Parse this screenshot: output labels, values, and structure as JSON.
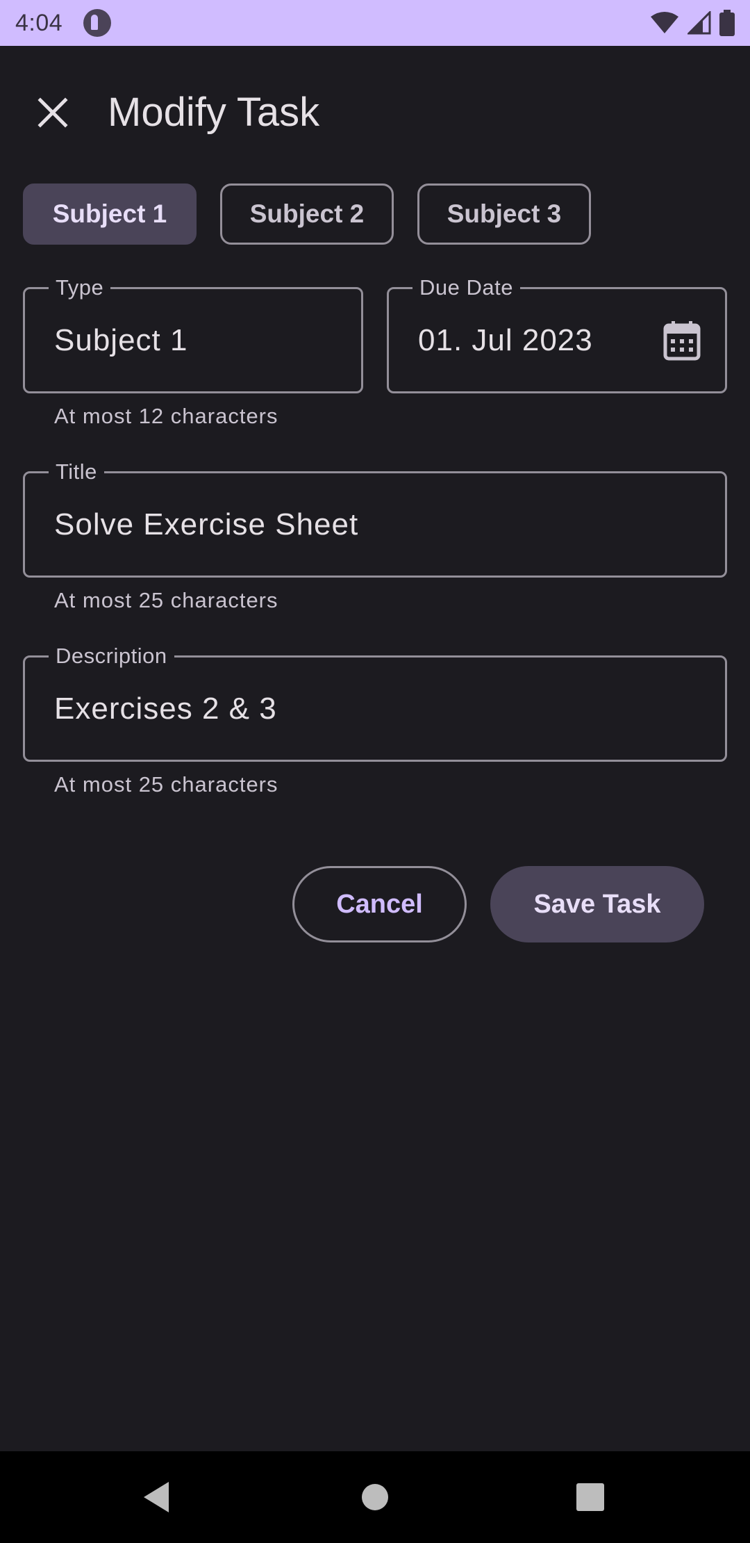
{
  "status_bar": {
    "time": "4:04",
    "icons": [
      "app-notification-icon",
      "wifi-icon",
      "signal-icon",
      "battery-icon"
    ]
  },
  "top_bar": {
    "title": "Modify Task",
    "close_icon": "close-icon"
  },
  "chips": [
    {
      "label": "Subject 1",
      "selected": true
    },
    {
      "label": "Subject 2",
      "selected": false
    },
    {
      "label": "Subject 3",
      "selected": false
    }
  ],
  "form": {
    "type": {
      "label": "Type",
      "value": "Subject 1",
      "supporting": "At most 12 characters"
    },
    "due_date": {
      "label": "Due Date",
      "value": "01. Jul 2023",
      "icon": "calendar-icon"
    },
    "title": {
      "label": "Title",
      "value": "Solve Exercise Sheet",
      "supporting": "At most 25 characters"
    },
    "description": {
      "label": "Description",
      "value": "Exercises 2 & 3",
      "supporting": "At most 25 characters"
    }
  },
  "actions": {
    "cancel_label": "Cancel",
    "save_label": "Save Task"
  },
  "nav_bar": {
    "icons": [
      "back-icon",
      "home-icon",
      "recents-icon"
    ]
  },
  "colors": {
    "background": "#1c1b20",
    "status_bar": "#d0bcff",
    "selected_chip": "#4a4458",
    "accent": "#d0bcff",
    "outline": "#938f99"
  }
}
